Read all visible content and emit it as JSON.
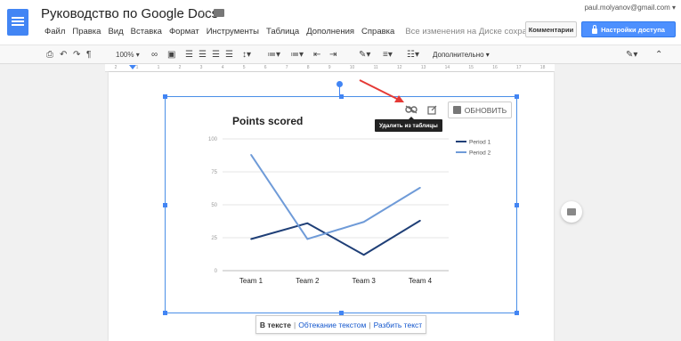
{
  "header": {
    "title": "Руководство по Google Docs",
    "user_email": "paul.molyanov@gmail.com",
    "comments_label": "Комментарии",
    "share_label": "Настройки доступа"
  },
  "menu": {
    "items": [
      "Файл",
      "Правка",
      "Вид",
      "Вставка",
      "Формат",
      "Инструменты",
      "Таблица",
      "Дополнения",
      "Справка"
    ],
    "saved_status": "Все изменения на Диске сохран..."
  },
  "toolbar": {
    "zoom": "100%",
    "more_label": "Дополнительно"
  },
  "ruler": {
    "ticks": [
      "2",
      "1",
      "1",
      "2",
      "3",
      "4",
      "5",
      "6",
      "7",
      "8",
      "9",
      "10",
      "11",
      "12",
      "13",
      "14",
      "15",
      "16",
      "17",
      "18"
    ]
  },
  "chart_actions": {
    "update_label": "ОБНОВИТЬ",
    "tooltip": "Удалить из таблицы"
  },
  "wrap_options": {
    "inline": "В тексте",
    "wrap": "Обтекание текстом",
    "break": "Разбить текст"
  },
  "chart_data": {
    "type": "line",
    "title": "Points scored",
    "categories": [
      "Team 1",
      "Team 2",
      "Team 3",
      "Team 4"
    ],
    "ylim": [
      0,
      100
    ],
    "yticks": [
      "0",
      "25",
      "50",
      "75",
      "100"
    ],
    "grid": true,
    "legend_position": "top-right",
    "series": [
      {
        "name": "Period 1",
        "color": "#1f3f77",
        "values": [
          24,
          36,
          12,
          38
        ]
      },
      {
        "name": "Period 2",
        "color": "#6f9bd8",
        "values": [
          88,
          24,
          37,
          63
        ]
      }
    ]
  },
  "colors": {
    "accent": "#4285f4",
    "share_button": "#4d90fe"
  }
}
